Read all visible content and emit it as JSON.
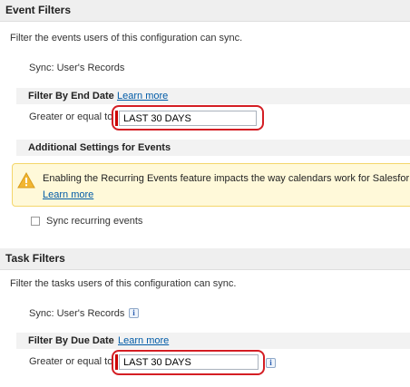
{
  "event_filters": {
    "title": "Event Filters",
    "description": "Filter the events users of this configuration can sync.",
    "sync": "Sync: User's Records",
    "end_date": {
      "title": "Filter By End Date",
      "learn_more": "Learn more",
      "label": "Greater or equal to",
      "value": "LAST 30 DAYS"
    },
    "additional": {
      "title": "Additional Settings for Events",
      "warning_text": "Enabling the Recurring Events feature impacts the way calendars work for Salesfor",
      "warning_link": "Learn more",
      "checkbox_label": "Sync recurring events",
      "checkbox_checked": false
    }
  },
  "task_filters": {
    "title": "Task Filters",
    "description": "Filter the tasks users of this configuration can sync.",
    "sync": "Sync: User's Records",
    "info": "i",
    "due_date": {
      "title": "Filter By Due Date",
      "learn_more": "Learn more",
      "label": "Greater or equal to",
      "value": "LAST 30 DAYS",
      "info": "i"
    }
  },
  "colors": {
    "header_bg": "#efefef",
    "link": "#015ba7",
    "highlight": "#d41e24",
    "warning_bg": "#fff9d9",
    "warning_icon": "#f2b632"
  }
}
